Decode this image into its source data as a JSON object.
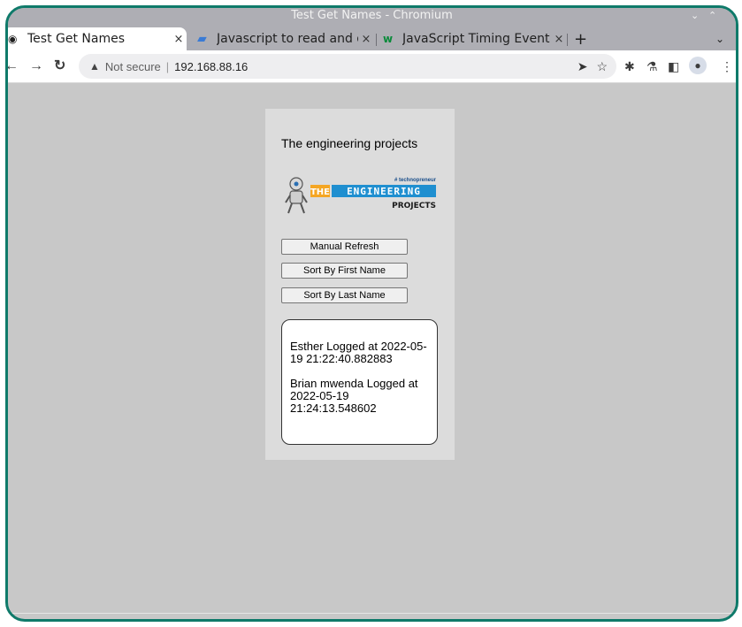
{
  "window": {
    "title": "Test Get Names - Chromium"
  },
  "tabs": [
    {
      "label": "Test Get Names"
    },
    {
      "label": "Javascript to read and d"
    },
    {
      "label": "JavaScript Timing Event"
    }
  ],
  "tab_close": "×",
  "new_tab": "+",
  "toolbar": {
    "security_label": "Not secure",
    "url": "192.168.88.16"
  },
  "page": {
    "heading": "The engineering projects",
    "logo": {
      "tag": "# technopreneur",
      "the": "THE",
      "engineering": "ENGINEERING",
      "projects": "PROJECTS"
    },
    "buttons": {
      "refresh": "Manual Refresh",
      "sort_first": "Sort By First Name",
      "sort_last": "Sort By Last Name"
    },
    "log_entries": [
      "Esther Logged at 2022-05-19 21:22:40.882883",
      "Brian mwenda Logged at 2022-05-19 21:24:13.548602"
    ]
  }
}
